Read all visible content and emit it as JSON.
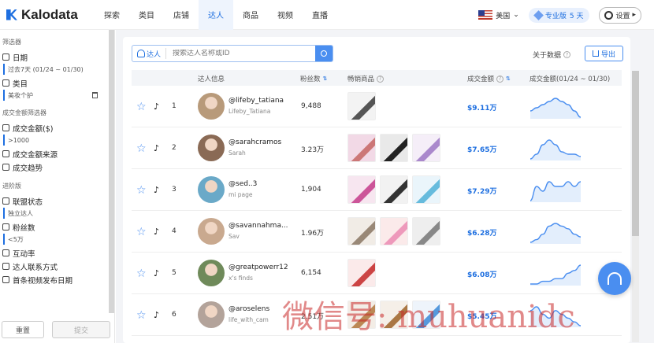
{
  "app": {
    "logo_text": "Kalodata",
    "brand_color": "#1e6fe0"
  },
  "nav": [
    {
      "label": "探索"
    },
    {
      "label": "类目"
    },
    {
      "label": "店铺"
    },
    {
      "label": "达人",
      "active": true
    },
    {
      "label": "商品"
    },
    {
      "label": "视频"
    },
    {
      "label": "直播"
    }
  ],
  "header_right": {
    "region": "美国",
    "plan": "专业版",
    "plan_days": "5 天",
    "settings": "设置"
  },
  "sidebar": {
    "filters_title": "筛选器",
    "date_label": "日期",
    "date_value": "过去7天 (01/24 ~ 01/30)",
    "category_label": "类目",
    "category_value": "美妆个护",
    "gmv_section": "成交金额筛选器",
    "gmv_label": "成交金额($)",
    "gmv_value": ">1000",
    "gmv_source_label": "成交金额来源",
    "gmv_trend_label": "成交趋势",
    "advanced_section": "进阶版",
    "affiliate_label": "联盟状态",
    "affiliate_value": "独立达人",
    "fans_label": "粉丝数",
    "fans_value": "<5万",
    "engagement_label": "互动率",
    "contact_label": "达人联系方式",
    "first_video_label": "首条视频发布日期",
    "reset_button": "重置",
    "submit_button": "提交"
  },
  "search": {
    "tag": "达人",
    "placeholder": "搜索达人名称或ID"
  },
  "toolbar": {
    "about_data": "关于数据",
    "export": "导出"
  },
  "table": {
    "headers": {
      "influencer": "达人信息",
      "fans": "粉丝数",
      "top_products": "畅销商品",
      "gmv": "成交金额",
      "gmv_trend": "成交金额(01/24 ~ 01/30)"
    },
    "rows": [
      {
        "rank": "1",
        "handle": "@lifeby_tatiana",
        "nickname": "Lifeby_Tatiana",
        "fans": "9,488",
        "gmv": "$9.11万",
        "trend": [
          3,
          4,
          5,
          6,
          7,
          6,
          5,
          3,
          1
        ]
      },
      {
        "rank": "2",
        "handle": "@sarahcramos",
        "nickname": "Sarah",
        "fans": "3.23万",
        "gmv": "$7.65万",
        "trend": [
          0,
          2,
          6,
          8,
          6,
          3,
          2,
          2,
          1
        ]
      },
      {
        "rank": "3",
        "handle": "@sed..3",
        "nickname": "mi page",
        "fans": "1,904",
        "gmv": "$7.29万",
        "trend": [
          1,
          4,
          3,
          5,
          4,
          4,
          5,
          4,
          5
        ]
      },
      {
        "rank": "4",
        "handle": "@savannahma...",
        "nickname": "Sav",
        "fans": "1.96万",
        "gmv": "$6.28万",
        "trend": [
          1,
          2,
          4,
          7,
          8,
          7,
          6,
          4,
          3
        ]
      },
      {
        "rank": "5",
        "handle": "@greatpowerr12",
        "nickname": "x's finds",
        "fans": "6,154",
        "gmv": "$6.08万",
        "trend": [
          1,
          1,
          2,
          2,
          3,
          3,
          5,
          6,
          8
        ]
      },
      {
        "rank": "6",
        "handle": "@aroselens",
        "nickname": "life_with_cam",
        "fans": "2.51万",
        "gmv": "$5.45万",
        "trend": [
          4,
          5,
          3,
          2,
          4,
          3,
          2,
          1,
          0
        ]
      }
    ]
  },
  "watermark": "微信号: muhuanidc"
}
